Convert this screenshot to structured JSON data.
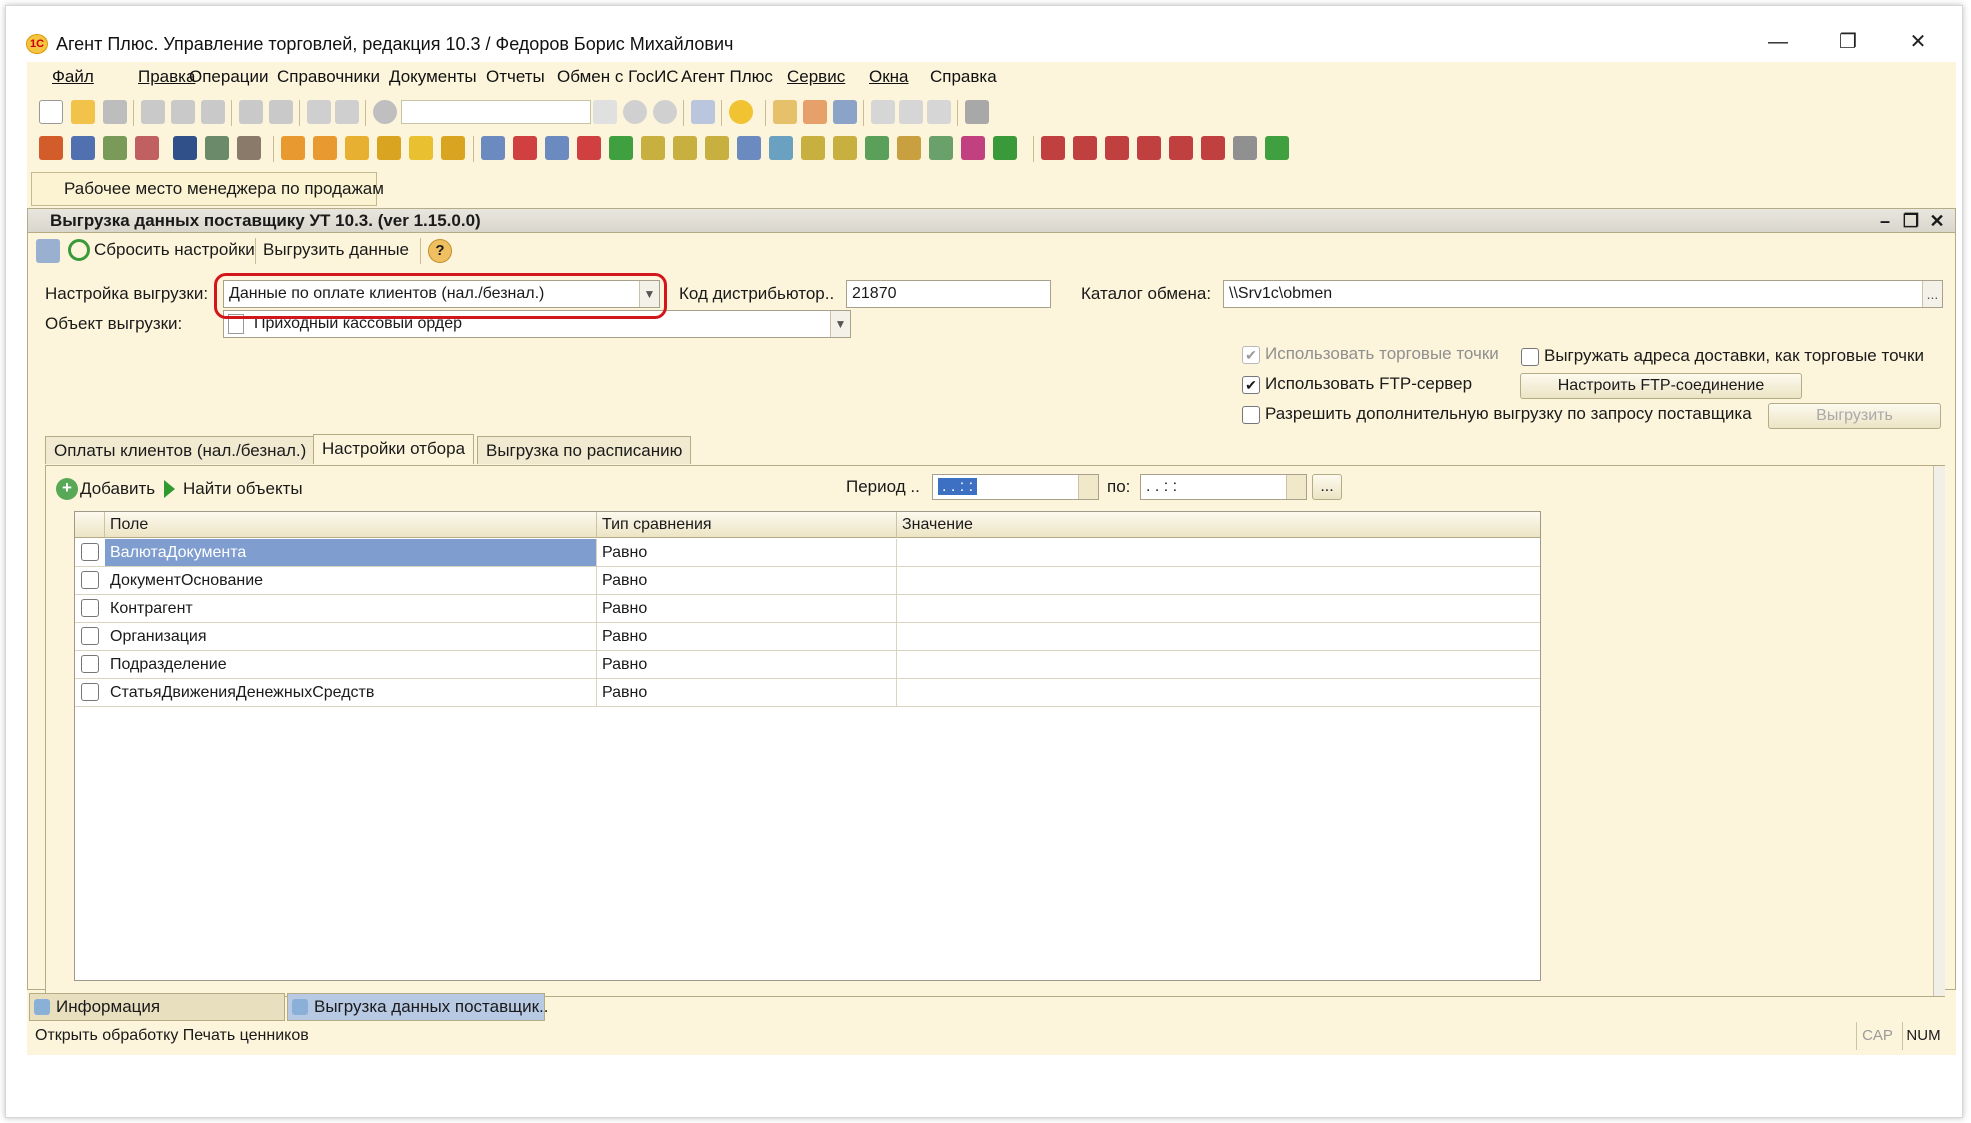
{
  "window": {
    "title": "Агент Плюс. Управление торговлей, редакция 10.3 / Федоров Борис Михайлович",
    "logo": "1С",
    "minimize": "—",
    "restore": "❐",
    "close": "✕"
  },
  "menu": {
    "items": [
      "Файл",
      "Правка",
      "Операции",
      "Справочники",
      "Документы",
      "Отчеты",
      "Обмен с ГосИС",
      "Агент Плюс",
      "Сервис",
      "Окна",
      "Справка"
    ]
  },
  "panel_tab": "Рабочее место менеджера по продажам",
  "inner_window": {
    "title": "Выгрузка данных поставщику УТ 10.3. (ver 1.15.0.0)",
    "commands": {
      "reset": "Сбросить настройки",
      "export": "Выгрузить данные",
      "help": "?"
    }
  },
  "form": {
    "setting_label": "Настройка выгрузки:",
    "setting_value": "Данные по оплате клиентов (нал./безнал.)",
    "distributor_code_label": "Код дистрибьютор..",
    "distributor_code_value": "21870",
    "exchange_dir_label": "Каталог обмена:",
    "exchange_dir_value": "\\\\Srv1c\\obmen",
    "object_label": "Объект выгрузки:",
    "object_value": "Приходный кассовый ордер",
    "opt_use_outlets": "Использовать торговые точки",
    "opt_export_delivery": "Выгружать адреса доставки, как торговые точки",
    "opt_use_ftp": "Использовать FTP-сервер",
    "btn_configure_ftp": "Настроить FTP-соединение",
    "opt_allow_extra": "Разрешить дополнительную выгрузку по запросу поставщика",
    "btn_export": "Выгрузить",
    "ellipsis": "..."
  },
  "tabs": [
    "Оплаты клиентов (нал./безнал.)",
    "Настройки отбора",
    "Выгрузка по расписанию"
  ],
  "filter": {
    "add": "Добавить",
    "find": "Найти объекты",
    "period_label": "Период ..",
    "period_from": " .  .     :  :",
    "period_to_label": "по:",
    "period_to": " .  .     :  :",
    "period_btn": "..."
  },
  "table": {
    "columns": [
      "Поле",
      "Тип сравнения",
      "Значение"
    ],
    "rows": [
      {
        "field": "ВалютаДокумента",
        "compare": "Равно",
        "value": ""
      },
      {
        "field": "ДокументОснование",
        "compare": "Равно",
        "value": ""
      },
      {
        "field": "Контрагент",
        "compare": "Равно",
        "value": ""
      },
      {
        "field": "Организация",
        "compare": "Равно",
        "value": ""
      },
      {
        "field": "Подразделение",
        "compare": "Равно",
        "value": ""
      },
      {
        "field": "СтатьяДвиженияДенежныхСредств",
        "compare": "Равно",
        "value": ""
      }
    ]
  },
  "window_tabs": [
    "Информация",
    "Выгрузка данных поставщик.."
  ],
  "status": {
    "text": "Открыть обработку Печать ценников",
    "cap": "CAP",
    "num": "NUM"
  },
  "colors": {
    "chrome_bg": "#fcf5db",
    "highlight_oval": "#d2161c",
    "selected_row": "#7f9ecf"
  }
}
